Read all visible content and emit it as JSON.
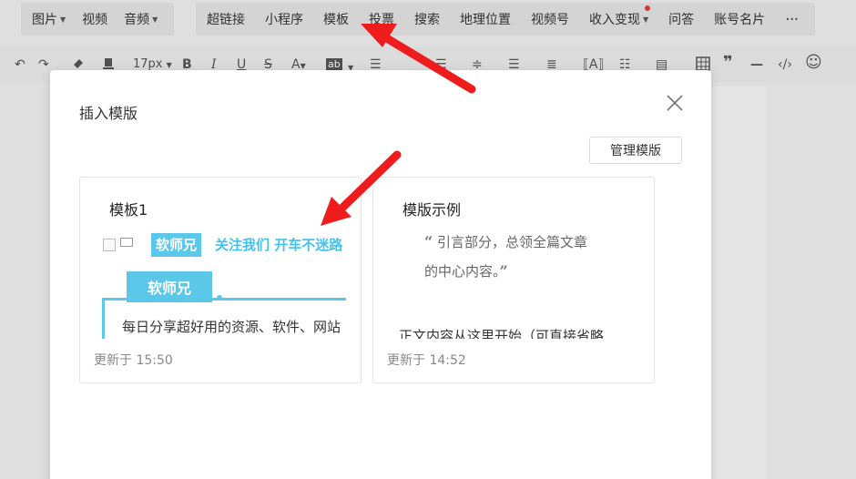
{
  "toolbar_primary": {
    "group1": [
      {
        "label": "图片",
        "dropdown": true
      },
      {
        "label": "视频",
        "dropdown": false
      },
      {
        "label": "音频",
        "dropdown": true
      }
    ],
    "group2": [
      {
        "label": "超链接"
      },
      {
        "label": "小程序"
      },
      {
        "label": "模板"
      },
      {
        "label": "投票"
      },
      {
        "label": "搜索"
      },
      {
        "label": "地理位置"
      },
      {
        "label": "视频号"
      },
      {
        "label": "收入变现",
        "dropdown": true,
        "badge_dot": true
      },
      {
        "label": "问答"
      },
      {
        "label": "账号名片"
      }
    ],
    "more_label": "···"
  },
  "format_toolbar": {
    "font_size": "17px",
    "bold": "B",
    "italic": "I",
    "underline": "U",
    "strike": "S",
    "font_color": "A",
    "highlight": "ab",
    "quote_glyph": "❞",
    "hr_glyph": "—",
    "code_glyph": "‹/›",
    "emoji_glyph": "☺"
  },
  "dialog": {
    "title": "插入模版",
    "manage_button": "管理模版",
    "templates": [
      {
        "name": "模板1",
        "updated": "更新于 15:50",
        "preview": {
          "badge": "软师兄",
          "follow_text": "关注我们 开车不迷路",
          "badge2": "软师兄",
          "desc": "每日分享超好用的资源、软件、网站"
        }
      },
      {
        "name": "模版示例",
        "updated": "更新于 14:52",
        "preview": {
          "quote_line1": "引言部分，总领全篇文章",
          "quote_line2": "的中心内容。",
          "quote_open": "“",
          "quote_close": "”",
          "body": "正文内容从这里开始（可直接省略"
        }
      }
    ]
  },
  "colors": {
    "accent_blue": "#5bc8ea",
    "arrow_red": "#ee1c1c",
    "notify_dot": "#e03b3b"
  }
}
